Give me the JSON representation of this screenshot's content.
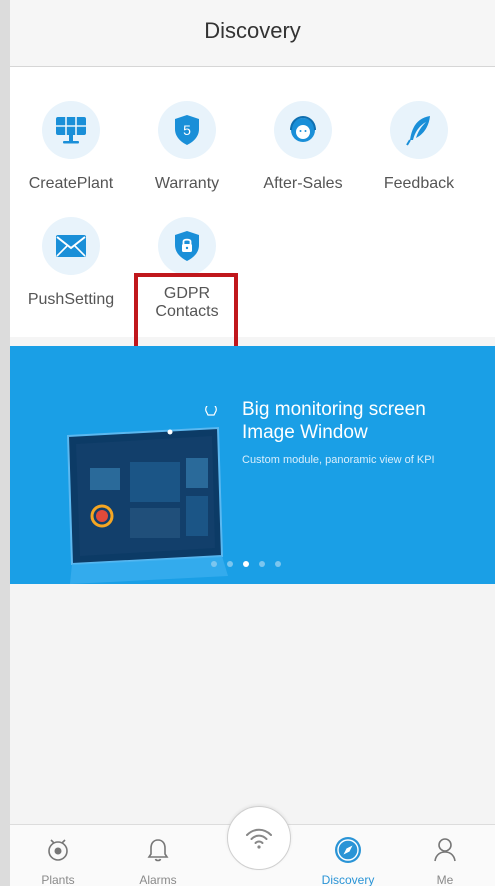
{
  "header": {
    "title": "Discovery"
  },
  "grid": {
    "items": [
      {
        "label": "CreatePlant",
        "icon": "solar-panel-icon"
      },
      {
        "label": "Warranty",
        "icon": "warranty-shield-icon",
        "badge": "5"
      },
      {
        "label": "After-Sales",
        "icon": "customer-service-icon"
      },
      {
        "label": "Feedback",
        "icon": "feather-pen-icon"
      },
      {
        "label": "PushSetting",
        "icon": "envelope-icon"
      },
      {
        "label_line1": "GDPR",
        "label_line2": "Contacts",
        "icon": "lock-shield-icon"
      }
    ]
  },
  "banner": {
    "title_line1": "Big monitoring screen",
    "title_line2": "Image Window",
    "subtitle": "Custom module, panoramic view of KPI",
    "active_slide": 3,
    "slide_count": 5
  },
  "tabbar": {
    "items": [
      {
        "label": "Plants",
        "icon": "plants-icon"
      },
      {
        "label": "Alarms",
        "icon": "bell-icon"
      },
      {
        "label": "Discovery",
        "icon": "compass-icon",
        "active": true
      },
      {
        "label": "Me",
        "icon": "person-icon"
      }
    ],
    "center_icon": "wifi-icon"
  },
  "colors": {
    "accent": "#1a9fe6",
    "highlight": "#c0171c",
    "active_tab": "#2a94d6"
  }
}
